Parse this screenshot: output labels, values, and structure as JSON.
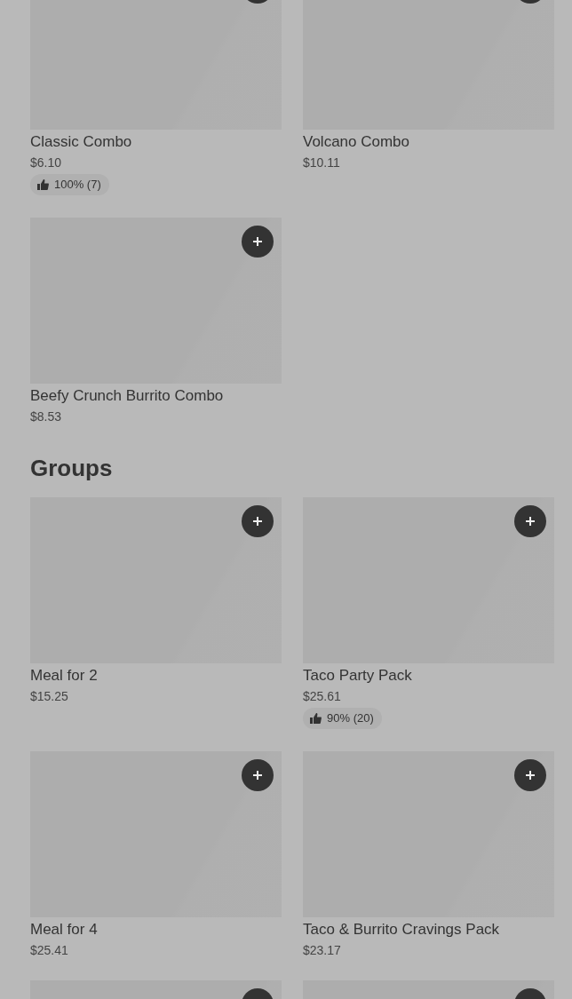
{
  "sections": [
    {
      "items": [
        {
          "name": "Classic Combo",
          "price": "$6.10",
          "rating": "100% (7)",
          "add_button": true
        },
        {
          "name": "Volcano Combo",
          "price": "$10.11",
          "add_button": true
        },
        {
          "name": "Beefy Crunch Burrito Combo",
          "price": "$8.53",
          "add_button": true
        }
      ]
    },
    {
      "title": "Groups",
      "items": [
        {
          "name": "Meal for 2",
          "price": "$15.25",
          "add_button": true
        },
        {
          "name": "Taco Party Pack",
          "price": "$25.61",
          "rating": "90% (20)",
          "add_button": true
        },
        {
          "name": "Meal for 4",
          "price": "$25.41",
          "add_button": true
        },
        {
          "name": "Taco & Burrito Cravings Pack",
          "price": "$23.17",
          "add_button": true
        },
        {
          "add_button": true
        },
        {
          "add_button": true
        }
      ]
    }
  ]
}
